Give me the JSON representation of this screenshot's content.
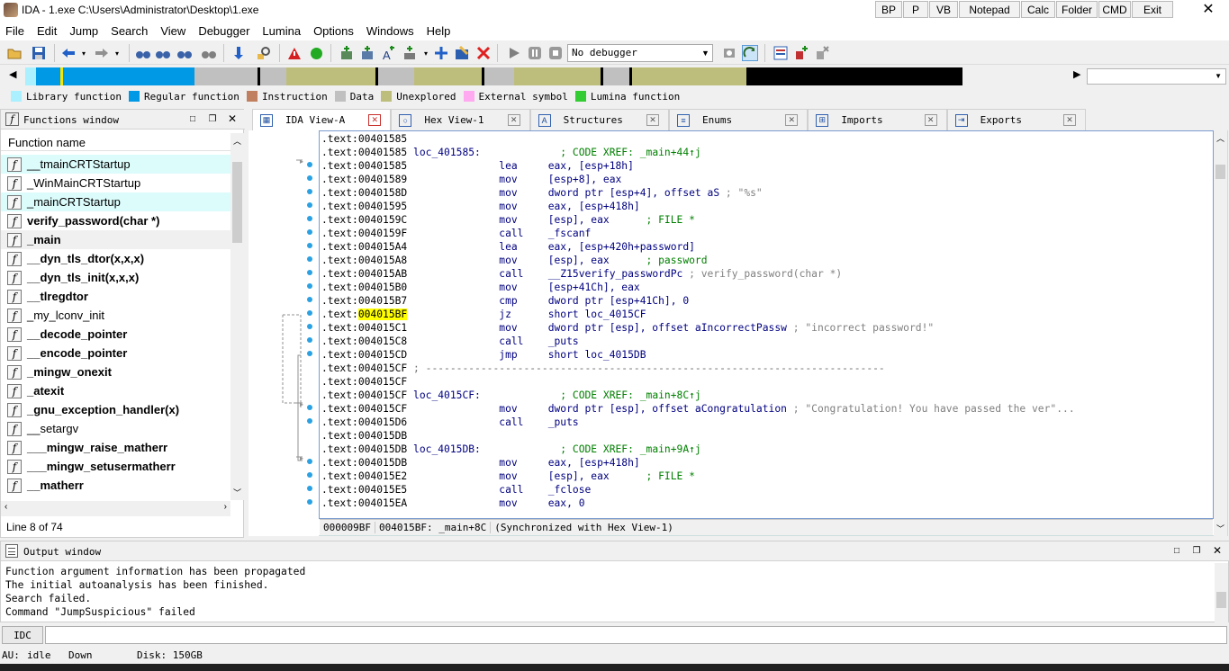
{
  "window": {
    "title": "IDA - 1.exe C:\\Users\\Administrator\\Desktop\\1.exe",
    "quick_buttons": [
      "BP",
      "P",
      "VB",
      "Notepad",
      "Calc",
      "Folder",
      "CMD",
      "Exit"
    ],
    "close": "✕"
  },
  "menu": [
    "File",
    "Edit",
    "Jump",
    "Search",
    "View",
    "Debugger",
    "Lumina",
    "Options",
    "Windows",
    "Help"
  ],
  "toolbar": {
    "debugger_select": "No debugger"
  },
  "legend": [
    {
      "label": "Library function",
      "color": "#aaf0ff"
    },
    {
      "label": "Regular function",
      "color": "#0099e6"
    },
    {
      "label": "Instruction",
      "color": "#c08060"
    },
    {
      "label": "Data",
      "color": "#c0c0c0"
    },
    {
      "label": "Unexplored",
      "color": "#bebe7c"
    },
    {
      "label": "External symbol",
      "color": "#ffaaf0"
    },
    {
      "label": "Lumina function",
      "color": "#33cc33"
    }
  ],
  "functions_window": {
    "title": "Functions window",
    "column": "Function name",
    "items": [
      {
        "name": "__tmainCRTStartup",
        "bold": false,
        "style": "hl"
      },
      {
        "name": "_WinMainCRTStartup",
        "bold": false,
        "style": ""
      },
      {
        "name": "_mainCRTStartup",
        "bold": false,
        "style": "hl"
      },
      {
        "name": "verify_password(char *)",
        "bold": true,
        "style": ""
      },
      {
        "name": "_main",
        "bold": true,
        "style": "sel"
      },
      {
        "name": "__dyn_tls_dtor(x,x,x)",
        "bold": true,
        "style": ""
      },
      {
        "name": "__dyn_tls_init(x,x,x)",
        "bold": true,
        "style": ""
      },
      {
        "name": "__tlregdtor",
        "bold": true,
        "style": ""
      },
      {
        "name": "_my_lconv_init",
        "bold": false,
        "style": ""
      },
      {
        "name": "__decode_pointer",
        "bold": true,
        "style": ""
      },
      {
        "name": "__encode_pointer",
        "bold": true,
        "style": ""
      },
      {
        "name": "_mingw_onexit",
        "bold": true,
        "style": ""
      },
      {
        "name": "_atexit",
        "bold": true,
        "style": ""
      },
      {
        "name": "_gnu_exception_handler(x)",
        "bold": true,
        "style": ""
      },
      {
        "name": "__setargv",
        "bold": false,
        "style": ""
      },
      {
        "name": "___mingw_raise_matherr",
        "bold": true,
        "style": ""
      },
      {
        "name": "___mingw_setusermatherr",
        "bold": true,
        "style": ""
      },
      {
        "name": "__matherr",
        "bold": true,
        "style": ""
      }
    ],
    "status": "Line 8 of 74"
  },
  "tabs": [
    {
      "label": "IDA View-A",
      "icon": "▦",
      "active": true
    },
    {
      "label": "Hex View-1",
      "icon": "○",
      "active": false
    },
    {
      "label": "Structures",
      "icon": "A",
      "active": false
    },
    {
      "label": "Enums",
      "icon": "≡",
      "active": false
    },
    {
      "label": "Imports",
      "icon": "⊞",
      "active": false
    },
    {
      "label": "Exports",
      "icon": "⇥",
      "active": false
    }
  ],
  "disasm": {
    "lines": [
      {
        "seg": ".text:",
        "addr": "00401585",
        "rest": ""
      },
      {
        "seg": ".text:",
        "addr": "00401585",
        "label": "loc_401585:",
        "comment": "; CODE XREF: _main+44↑j"
      },
      {
        "seg": ".text:",
        "addr": "00401585",
        "mn": "lea",
        "op": "eax, [esp+18h]"
      },
      {
        "seg": ".text:",
        "addr": "00401589",
        "mn": "mov",
        "op": "[esp+8], eax"
      },
      {
        "seg": ".text:",
        "addr": "0040158D",
        "mn": "mov",
        "op": "dword ptr [esp+4], offset aS",
        "cmt": " ; \"%s\""
      },
      {
        "seg": ".text:",
        "addr": "00401595",
        "mn": "mov",
        "op": "eax, [esp+418h]"
      },
      {
        "seg": ".text:",
        "addr": "0040159C",
        "mn": "mov",
        "op": "[esp], eax",
        "cmt2": "      ; FILE *"
      },
      {
        "seg": ".text:",
        "addr": "0040159F",
        "mn": "call",
        "op": "_fscanf"
      },
      {
        "seg": ".text:",
        "addr": "004015A4",
        "mn": "lea",
        "op": "eax, [esp+420h+password]"
      },
      {
        "seg": ".text:",
        "addr": "004015A8",
        "mn": "mov",
        "op": "[esp], eax",
        "cmt2": "      ; password"
      },
      {
        "seg": ".text:",
        "addr": "004015AB",
        "mn": "call",
        "op": "__Z15verify_passwordPc",
        "cmt": " ; verify_password(char *)"
      },
      {
        "seg": ".text:",
        "addr": "004015B0",
        "mn": "mov",
        "op": "[esp+41Ch], eax"
      },
      {
        "seg": ".text:",
        "addr": "004015B7",
        "mn": "cmp",
        "op": "dword ptr [esp+41Ch], 0"
      },
      {
        "seg": ".text:",
        "addr": "004015BF",
        "mn": "jz",
        "op": "short loc_4015CF",
        "hl": true
      },
      {
        "seg": ".text:",
        "addr": "004015C1",
        "mn": "mov",
        "op": "dword ptr [esp], offset aIncorrectPassw",
        "cmt": " ; \"incorrect password!\""
      },
      {
        "seg": ".text:",
        "addr": "004015C8",
        "mn": "call",
        "op": "_puts"
      },
      {
        "seg": ".text:",
        "addr": "004015CD",
        "mn": "jmp",
        "op": "short loc_4015DB"
      },
      {
        "seg": ".text:",
        "addr": "004015CF",
        "sep": " ; ---------------------------------------------------------------------------"
      },
      {
        "seg": ".text:",
        "addr": "004015CF",
        "rest": ""
      },
      {
        "seg": ".text:",
        "addr": "004015CF",
        "label": "loc_4015CF:",
        "comment": "; CODE XREF: _main+8C↑j"
      },
      {
        "seg": ".text:",
        "addr": "004015CF",
        "mn": "mov",
        "op": "dword ptr [esp], offset aCongratulation",
        "cmt": " ; \"Congratulation! You have passed the ver\"..."
      },
      {
        "seg": ".text:",
        "addr": "004015D6",
        "mn": "call",
        "op": "_puts"
      },
      {
        "seg": ".text:",
        "addr": "004015DB",
        "rest": ""
      },
      {
        "seg": ".text:",
        "addr": "004015DB",
        "label": "loc_4015DB:",
        "comment": "; CODE XREF: _main+9A↑j"
      },
      {
        "seg": ".text:",
        "addr": "004015DB",
        "mn": "mov",
        "op": "eax, [esp+418h]"
      },
      {
        "seg": ".text:",
        "addr": "004015E2",
        "mn": "mov",
        "op": "[esp], eax",
        "cmt2": "      ; FILE *"
      },
      {
        "seg": ".text:",
        "addr": "004015E5",
        "mn": "call",
        "op": "_fclose"
      },
      {
        "seg": ".text:",
        "addr": "004015EA",
        "mn": "mov",
        "op": "eax, 0"
      }
    ],
    "status": [
      "000009BF",
      "004015BF: _main+8C",
      "(Synchronized with Hex View-1)"
    ]
  },
  "output_window": {
    "title": "Output window",
    "lines": [
      "Function argument information has been propagated",
      "The initial autoanalysis has been finished.",
      "Search failed.",
      "Command \"JumpSuspicious\" failed"
    ]
  },
  "idc": {
    "button": "IDC"
  },
  "statusbar": {
    "au": "AU:",
    "state": "idle",
    "dir": "Down",
    "disk": "Disk: 150GB"
  }
}
